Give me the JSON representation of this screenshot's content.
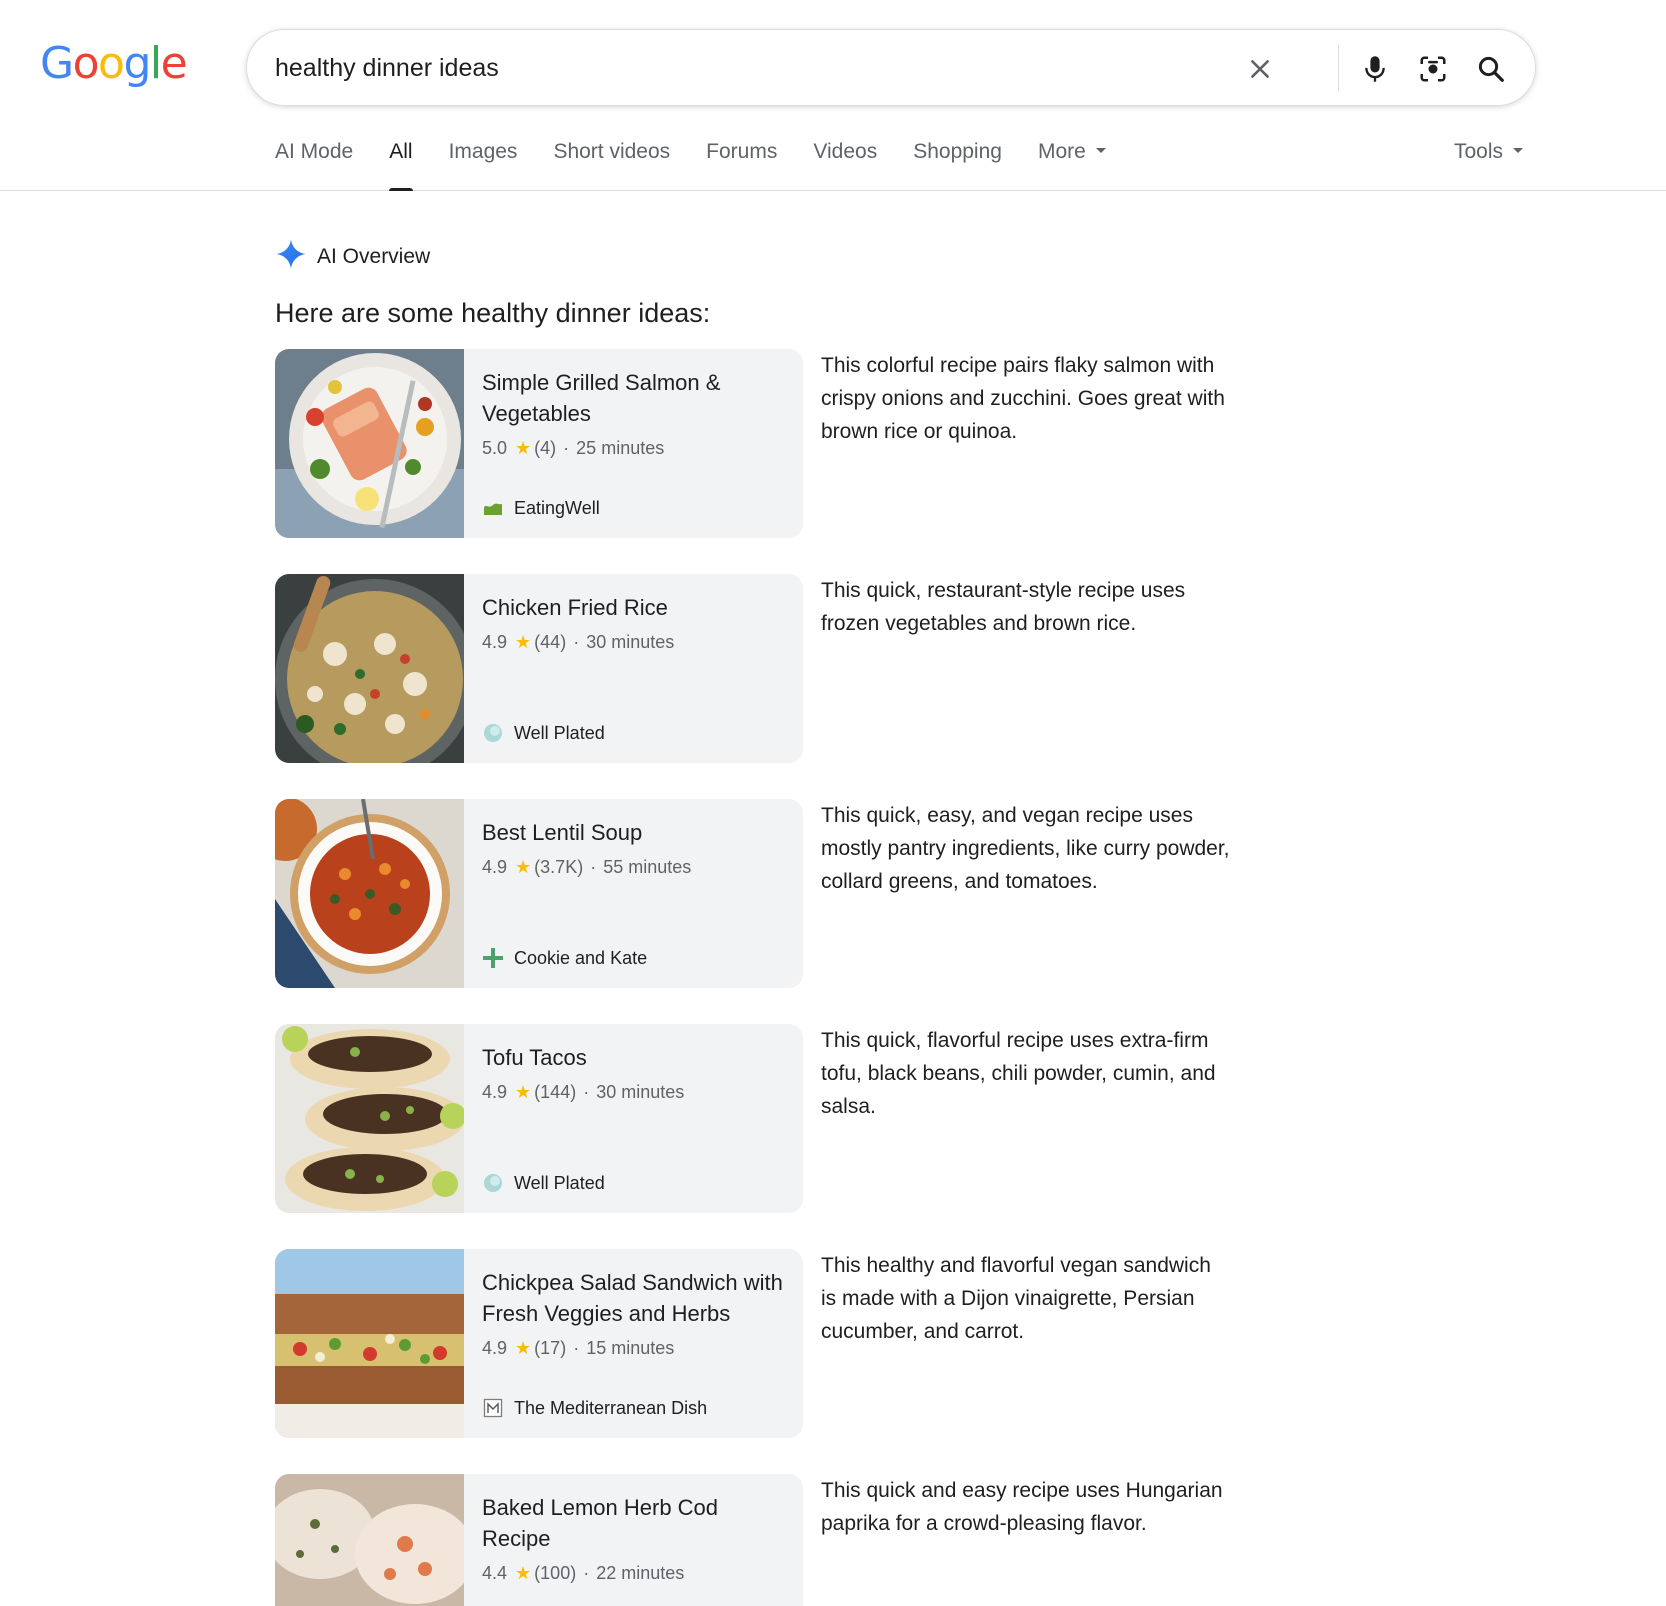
{
  "header": {
    "logo_letters": [
      {
        "ch": "G",
        "cls": "b"
      },
      {
        "ch": "o",
        "cls": "r"
      },
      {
        "ch": "o",
        "cls": "y"
      },
      {
        "ch": "g",
        "cls": "b"
      },
      {
        "ch": "l",
        "cls": "g"
      },
      {
        "ch": "e",
        "cls": "r"
      }
    ],
    "search_query": "healthy dinner ideas",
    "icons": [
      "close-icon",
      "microphone-icon",
      "camera-lens-icon",
      "search-icon"
    ]
  },
  "tabs": [
    {
      "label": "AI Mode",
      "active": false
    },
    {
      "label": "All",
      "active": true
    },
    {
      "label": "Images",
      "active": false
    },
    {
      "label": "Short videos",
      "active": false
    },
    {
      "label": "Forums",
      "active": false
    },
    {
      "label": "Videos",
      "active": false
    },
    {
      "label": "Shopping",
      "active": false
    },
    {
      "label": "More",
      "active": false,
      "dropdown": true
    }
  ],
  "tools_label": "Tools",
  "ai_overview": {
    "label": "AI Overview",
    "intro": "Here are some healthy dinner ideas:"
  },
  "recipes": [
    {
      "title": "Simple Grilled Salmon & Vegetables",
      "rating": "5.0",
      "reviews": "(4)",
      "time": "25 minutes",
      "source": "EatingWell",
      "source_icon": "eatingwell-icon",
      "description": "This colorful recipe pairs flaky salmon with crispy onions and zucchini. Goes great with brown rice or quinoa."
    },
    {
      "title": "Chicken Fried Rice",
      "rating": "4.9",
      "reviews": "(44)",
      "time": "30 minutes",
      "source": "Well Plated",
      "source_icon": "wellplated-icon",
      "description": "This quick, restaurant-style recipe uses frozen vegetables and brown rice."
    },
    {
      "title": "Best Lentil Soup",
      "rating": "4.9",
      "reviews": "(3.7K)",
      "time": "55 minutes",
      "source": "Cookie and Kate",
      "source_icon": "cookieandkate-icon",
      "description": "This quick, easy, and vegan recipe uses mostly pantry ingredients, like curry powder, collard greens, and tomatoes."
    },
    {
      "title": "Tofu Tacos",
      "rating": "4.9",
      "reviews": "(144)",
      "time": "30 minutes",
      "source": "Well Plated",
      "source_icon": "wellplated-icon",
      "description": "This quick, flavorful recipe uses extra-firm tofu, black beans, chili powder, cumin, and salsa."
    },
    {
      "title": "Chickpea Salad Sandwich with Fresh Veggies and Herbs",
      "rating": "4.9",
      "reviews": "(17)",
      "time": "15 minutes",
      "source": "The Mediterranean Dish",
      "source_icon": "mediterraneandish-icon",
      "description": "This healthy and flavorful vegan sandwich is made with a Dijon vinaigrette, Persian cucumber, and carrot."
    },
    {
      "title": "Baked Lemon Herb Cod Recipe",
      "rating": "4.4",
      "reviews": "(100)",
      "time": "22 minutes",
      "source": "",
      "source_icon": "",
      "description": "This quick and easy recipe uses Hungarian paprika for a crowd-pleasing flavor."
    }
  ],
  "colors": {
    "google_blue": "#4285f4",
    "google_red": "#ea4335",
    "google_yellow": "#fbbc05",
    "google_green": "#34a853",
    "star": "#fbbc04",
    "card_bg": "#f1f3f4",
    "muted_text": "#5f6368"
  }
}
